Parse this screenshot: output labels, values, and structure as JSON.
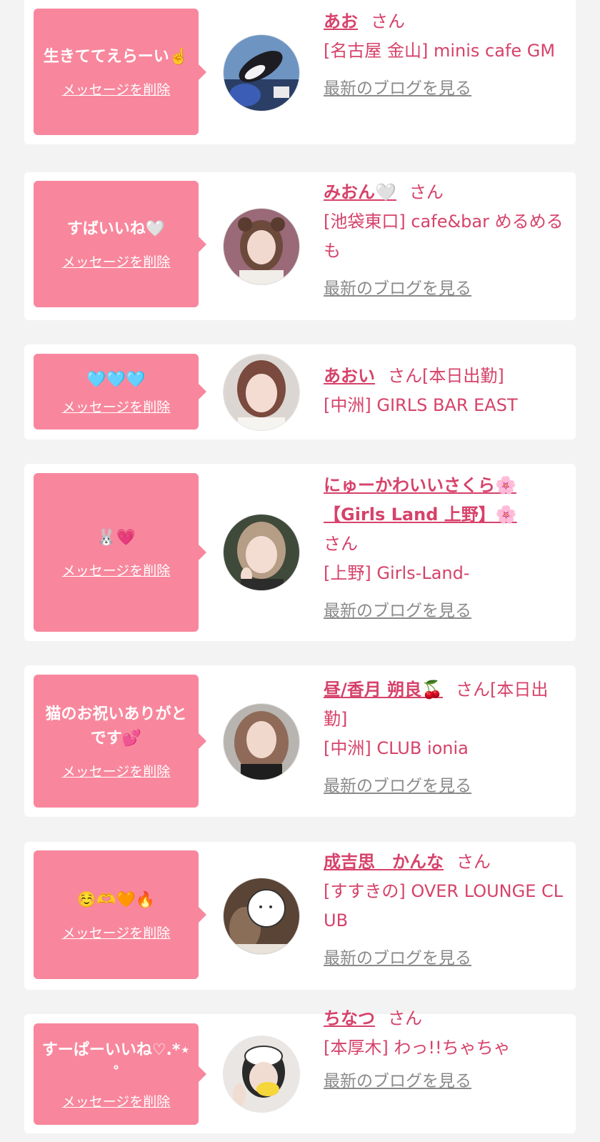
{
  "delete_label": "メッセージを削除",
  "blog_label": "最新のブログを見る",
  "colors": {
    "bubble": "#f8879d",
    "accent": "#d6426a",
    "link_gray": "#8a8a8a",
    "background": "#f3f3f3"
  },
  "cards": [
    {
      "message": "生きててえらーい☝️",
      "name": "あお",
      "suffix": "さん",
      "status": "",
      "shop": "[名古屋 金山] minis cafe GM",
      "avatar": "photo-orca-aquarium"
    },
    {
      "message": "すばいいね🤍",
      "name": "みおん🤍",
      "suffix": "さん",
      "status": "",
      "shop": "[池袋東口] cafe&bar めるめるも",
      "avatar": "photo-girl-bear-ears"
    },
    {
      "message": "🩵🩵🩵",
      "name": "あおい",
      "suffix": "さん",
      "status": "[本日出勤]",
      "shop": "[中洲] GIRLS BAR EAST",
      "avatar": "photo-girl-portrait"
    },
    {
      "message": "🐰💗",
      "name": "にゅーかわいいさくら🌸【Girls Land 上野】🌸",
      "suffix": "さん",
      "status": "",
      "shop": "[上野] Girls-Land-",
      "avatar": "photo-girl-peace"
    },
    {
      "message": "猫のお祝いありがとです💕",
      "name": "昼/香月 朔良🍒",
      "suffix": "さん",
      "status": "[本日出勤]",
      "shop": "[中洲] CLUB ionia",
      "avatar": "photo-girl-long-hair"
    },
    {
      "message": "☺️🫶🧡🔥",
      "name": "成吉思　かんな",
      "suffix": "さん",
      "status": "",
      "shop": "[すすきの] OVER LOUNGE CLUB",
      "avatar": "photo-sheep-sticker"
    },
    {
      "message": "すーぱーいいね♡.*⋆˚",
      "name": "ちなつ",
      "suffix": "さん",
      "status": "",
      "shop": "[本厚木] わっ!!ちゃちゃ",
      "avatar": "photo-girl-sticker"
    }
  ]
}
